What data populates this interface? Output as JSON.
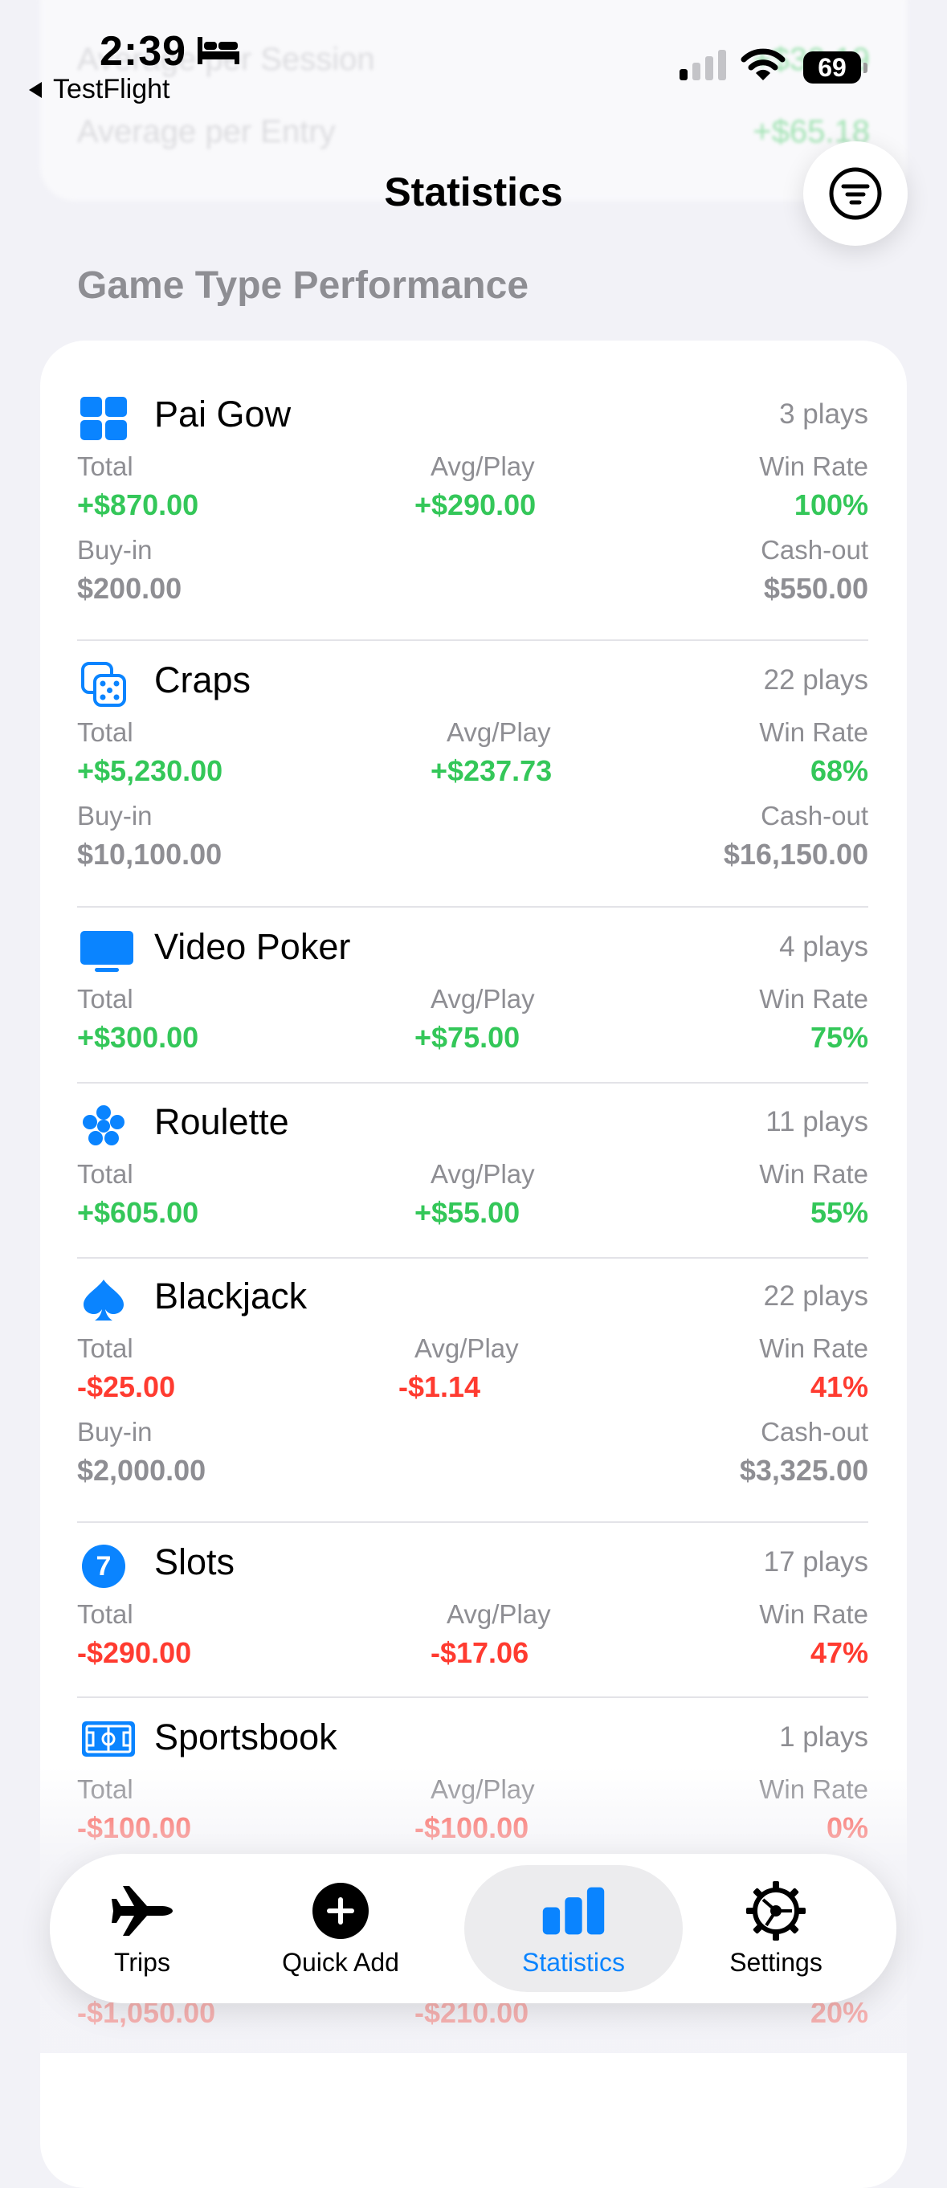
{
  "status_bar": {
    "time": "2:39",
    "back_label": "TestFlight",
    "battery": "69"
  },
  "ghost": [
    {
      "label": "Average per Session",
      "value": "+$30.19"
    },
    {
      "label": "Average per Entry",
      "value": "+$65.18"
    }
  ],
  "header": {
    "title": "Statistics"
  },
  "section_title": "Game Type Performance",
  "labels": {
    "total": "Total",
    "avg": "Avg/Play",
    "win_rate": "Win Rate",
    "buy_in": "Buy-in",
    "cash_out": "Cash-out"
  },
  "games": [
    {
      "name": "Pai Gow",
      "icon": "grid-icon",
      "plays": "3 plays",
      "total": "+$870.00",
      "avg": "+$290.00",
      "win_rate": "100%",
      "buy_in": "$200.00",
      "cash_out": "$550.00",
      "positive": true
    },
    {
      "name": "Craps",
      "icon": "dice-icon",
      "plays": "22 plays",
      "total": "+$5,230.00",
      "avg": "+$237.73",
      "win_rate": "68%",
      "buy_in": "$10,100.00",
      "cash_out": "$16,150.00",
      "positive": true
    },
    {
      "name": "Video Poker",
      "icon": "display-icon",
      "plays": "4 plays",
      "total": "+$300.00",
      "avg": "+$75.00",
      "win_rate": "75%",
      "positive": true
    },
    {
      "name": "Roulette",
      "icon": "circles-icon",
      "plays": "11 plays",
      "total": "+$605.00",
      "avg": "+$55.00",
      "win_rate": "55%",
      "positive": true
    },
    {
      "name": "Blackjack",
      "icon": "spade-icon",
      "plays": "22 plays",
      "total": "-$25.00",
      "avg": "-$1.14",
      "win_rate": "41%",
      "buy_in": "$2,000.00",
      "cash_out": "$3,325.00",
      "positive": false
    },
    {
      "name": "Slots",
      "icon": "seven-icon",
      "icon_text": "7",
      "plays": "17 plays",
      "total": "-$290.00",
      "avg": "-$17.06",
      "win_rate": "47%",
      "positive": false
    },
    {
      "name": "Sportsbook",
      "icon": "field-icon",
      "plays": "1 plays",
      "total": "-$100.00",
      "avg": "-$100.00",
      "win_rate": "0%",
      "positive": false
    }
  ],
  "hidden_row": {
    "total": "-$1,050.00",
    "avg": "-$210.00",
    "win_rate": "20%"
  },
  "tabs": [
    {
      "label": "Trips",
      "icon": "airplane-icon"
    },
    {
      "label": "Quick Add",
      "icon": "plus-circle-icon"
    },
    {
      "label": "Statistics",
      "icon": "bar-chart-icon",
      "active": true
    },
    {
      "label": "Settings",
      "icon": "gear-icon"
    }
  ],
  "colors": {
    "green": "#34c759",
    "red": "#ff3b30",
    "blue": "#0a84ff",
    "gray": "#8e8e93"
  }
}
